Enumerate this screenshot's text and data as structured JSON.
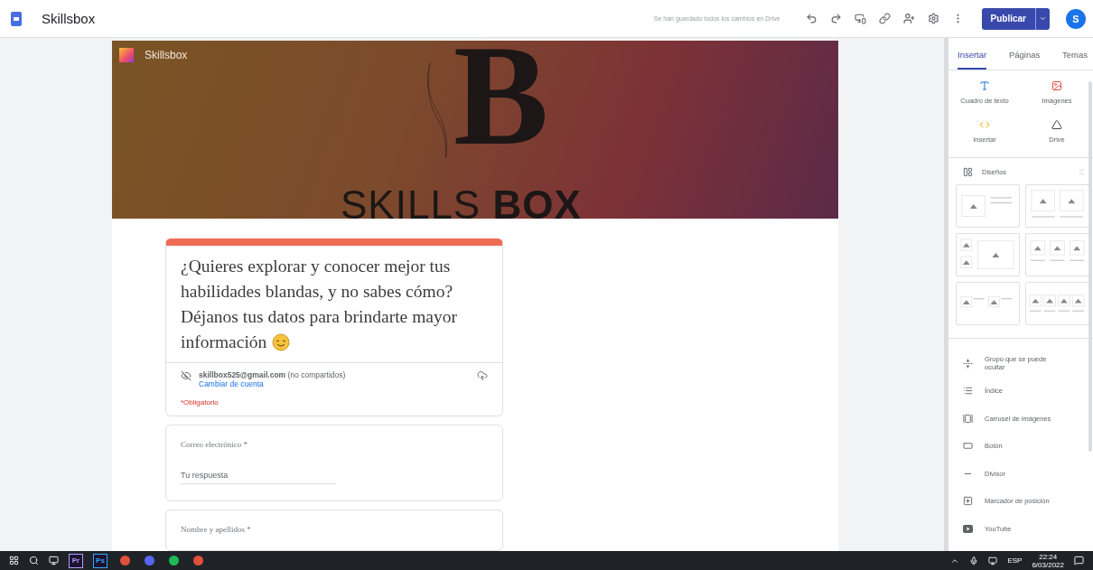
{
  "app": {
    "title": "Skillsbox",
    "save_status": "Se han guardado todos los cambios en Drive",
    "publish_button": "Publicar",
    "avatar": "S"
  },
  "banner": {
    "site_name": "Skillsbox",
    "monogram": "B",
    "brand": "SKILLS **BOX**"
  },
  "form": {
    "title": "¿Quieres explorar y conocer mejor tus habilidades blandas, y no sabes cómo? Déjanos tus datos para brindarte mayor información",
    "account": "**skillbox525@gmail.com** (no compartidos)",
    "switch_account": "Cambiar de cuenta",
    "required_note": "*Obligatorio",
    "questions": [
      {
        "label": "Correo electrónico *",
        "placeholder": "Tu respuesta"
      },
      {
        "label": "Nombre y apellidos *"
      }
    ]
  },
  "sidebar": {
    "tabs": [
      {
        "label": "Insertar",
        "selected": true
      },
      {
        "label": "Páginas",
        "selected": false
      },
      {
        "label": "Temas",
        "selected": false
      }
    ],
    "insert_items": [
      {
        "kind": "text",
        "label": "Cuadro de texto"
      },
      {
        "kind": "images",
        "label": "Imágenes"
      },
      {
        "kind": "embed",
        "label": "Insertar"
      },
      {
        "kind": "drive",
        "label": "Drive"
      }
    ],
    "layouts_title": "Diseños",
    "components": [
      {
        "kind": "collapsible",
        "label": "Grupo que se puede ocultar"
      },
      {
        "kind": "index",
        "label": "Índice"
      },
      {
        "kind": "carousel",
        "label": "Carrusel de imágenes"
      },
      {
        "kind": "button",
        "label": "Botón"
      },
      {
        "kind": "divider",
        "label": "Divisor"
      },
      {
        "kind": "placeholder",
        "label": "Marcador de posición"
      },
      {
        "kind": "youtube",
        "label": "YouTube"
      }
    ]
  },
  "taskbar": {
    "apps": [
      {
        "kind": "premiere",
        "label": "Pr"
      },
      {
        "kind": "photoshop",
        "label": "Ps"
      },
      {
        "kind": "chrome"
      },
      {
        "kind": "discord"
      },
      {
        "kind": "spotify"
      },
      {
        "kind": "chrome"
      }
    ],
    "language": "ESP",
    "time": "22:24",
    "date": "6/03/2022"
  }
}
